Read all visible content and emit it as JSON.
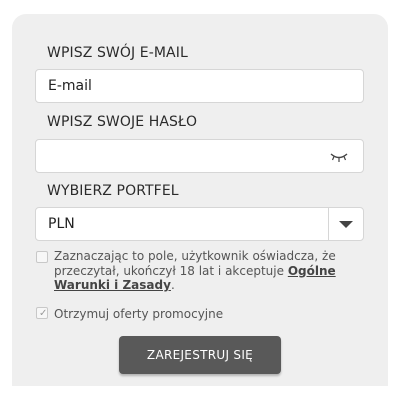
{
  "form": {
    "email": {
      "label": "WPISZ SWÓJ E-MAIL",
      "placeholder": "E-mail",
      "value": ""
    },
    "password": {
      "label": "WPISZ SWOJE HASŁO",
      "value": "",
      "toggle_icon": "eye-closed-icon"
    },
    "wallet": {
      "label": "WYBIERZ PORTFEL",
      "selected": "PLN"
    },
    "consent": {
      "checked": false,
      "text": "Zaznaczając to pole, użytkownik oświadcza, że przeczytał, ukończył 18 lat i akceptuje ",
      "link_text": "Ogólne Warunki i Zasady",
      "suffix": "."
    },
    "promo": {
      "checked": true,
      "text": "Otrzymuj oferty promocyjne"
    },
    "submit_label": "ZAREJESTRUJ SIĘ"
  },
  "colors": {
    "panel_bg": "#efefef",
    "button_bg": "#595959",
    "text": "#2b2b2b"
  }
}
